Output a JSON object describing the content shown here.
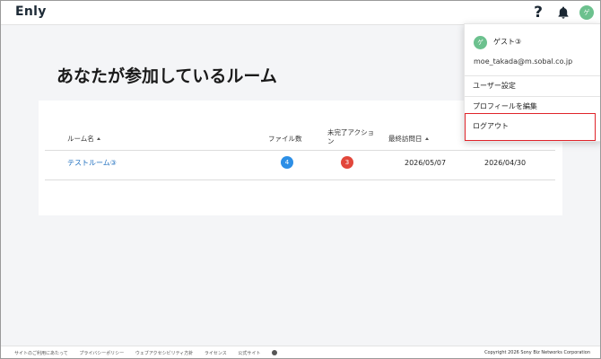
{
  "header": {
    "logo": "Enly",
    "help_label": "?",
    "avatar_initial": "ゲ"
  },
  "page": {
    "title": "あなたが参加しているルーム"
  },
  "table": {
    "columns": {
      "room_name": "ルーム名",
      "files": "ファイル数",
      "pending_actions_line1": "未完了アクショ",
      "pending_actions_line2": "ン",
      "last_visited": "最終訪問日"
    },
    "rows": [
      {
        "room_name": "テストルーム③",
        "files": "4",
        "pending_actions": "3",
        "last_visited": "2026/05/07",
        "last_updated": "2026/04/30"
      }
    ]
  },
  "user_menu": {
    "avatar_initial": "ゲ",
    "username": "ゲスト③",
    "email": "moe_takada@m.sobal.co.jp",
    "items": {
      "user_settings": "ユーザー設定",
      "edit_profile": "プロフィールを編集",
      "logout": "ログアウト"
    }
  },
  "footer": {
    "links": [
      "サイトのご利用にあたって",
      "プライバシーポリシー",
      "ウェブアクセシビリティ方針",
      "ライセンス",
      "公式サイト"
    ],
    "copyright": "Copyright 2026 Sony Biz Networks Corporation"
  },
  "colors": {
    "link": "#1f6fbf",
    "files_badge": "#2d8fe6",
    "actions_badge": "#e2473b",
    "avatar": "#6cc18e",
    "logout_highlight": "#e0242a"
  }
}
